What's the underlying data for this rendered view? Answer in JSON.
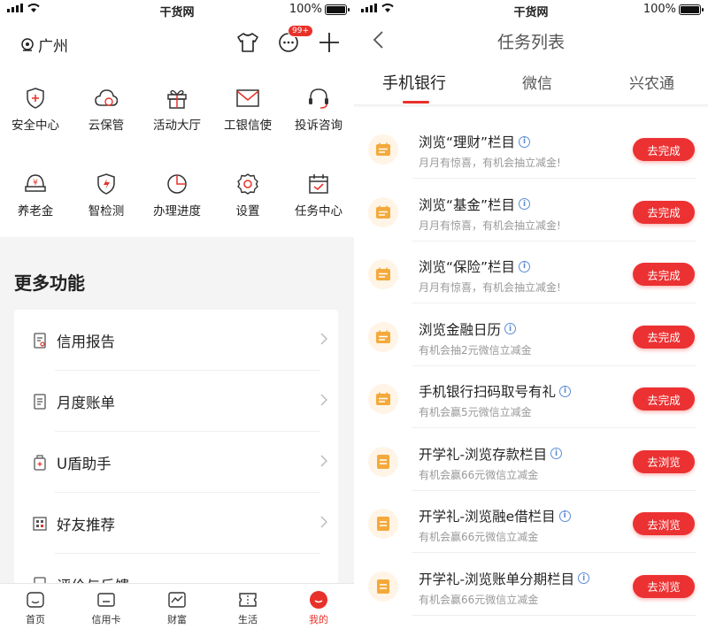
{
  "colors": {
    "accent": "#e8312a",
    "button": "#ec3132",
    "task_icon": "#f4a93b",
    "info": "#5b8bd6"
  },
  "status_bar": {
    "carrier": "干货网",
    "battery": "100%"
  },
  "left": {
    "location": "广州",
    "message_badge": "99+",
    "grid_row1": [
      {
        "label": "安全中心",
        "icon": "shield-plus-icon"
      },
      {
        "label": "云保管",
        "icon": "cloud-icon"
      },
      {
        "label": "活动大厅",
        "icon": "gift-icon"
      },
      {
        "label": "工银信使",
        "icon": "mail-icon"
      },
      {
        "label": "投诉咨询",
        "icon": "headset-icon"
      }
    ],
    "grid_row2": [
      {
        "label": "养老金",
        "icon": "pension-icon"
      },
      {
        "label": "智检测",
        "icon": "shield-bolt-icon"
      },
      {
        "label": "办理进度",
        "icon": "pie-chart-icon"
      },
      {
        "label": "设置",
        "icon": "gear-icon"
      },
      {
        "label": "任务中心",
        "icon": "calendar-check-icon"
      }
    ],
    "more_title": "更多功能",
    "more_items": [
      {
        "label": "信用报告",
        "icon": "report-icon"
      },
      {
        "label": "月度账单",
        "icon": "bill-icon"
      },
      {
        "label": "U盾助手",
        "icon": "usb-key-icon"
      },
      {
        "label": "好友推荐",
        "icon": "qr-icon"
      },
      {
        "label": "评价与反馈",
        "icon": "feedback-icon"
      }
    ],
    "tabs": [
      {
        "label": "首页",
        "icon": "home-icon"
      },
      {
        "label": "信用卡",
        "icon": "card-icon"
      },
      {
        "label": "财富",
        "icon": "wealth-icon"
      },
      {
        "label": "生活",
        "icon": "ticket-icon"
      },
      {
        "label": "我的",
        "icon": "profile-icon"
      }
    ]
  },
  "right": {
    "title": "任务列表",
    "tabs": [
      "手机银行",
      "微信",
      "兴农通"
    ],
    "tasks": [
      {
        "title": "浏览“理财”栏目",
        "sub": "月月有惊喜，有机会抽立减金!",
        "button": "去完成"
      },
      {
        "title": "浏览“基金”栏目",
        "sub": "月月有惊喜，有机会抽立减金!",
        "button": "去完成"
      },
      {
        "title": "浏览“保险”栏目",
        "sub": "月月有惊喜，有机会抽立减金!",
        "button": "去完成"
      },
      {
        "title": "浏览金融日历",
        "sub": "有机会抽2元微信立减金",
        "button": "去完成"
      },
      {
        "title": "手机银行扫码取号有礼",
        "sub": "有机会赢5元微信立减金",
        "button": "去完成"
      },
      {
        "title": "开学礼-浏览存款栏目",
        "sub": "有机会赢66元微信立减金",
        "button": "去浏览"
      },
      {
        "title": "开学礼-浏览融e借栏目",
        "sub": "有机会赢66元微信立减金",
        "button": "去浏览"
      },
      {
        "title": "开学礼-浏览账单分期栏目",
        "sub": "有机会赢66元微信立减金",
        "button": "去浏览"
      }
    ]
  }
}
